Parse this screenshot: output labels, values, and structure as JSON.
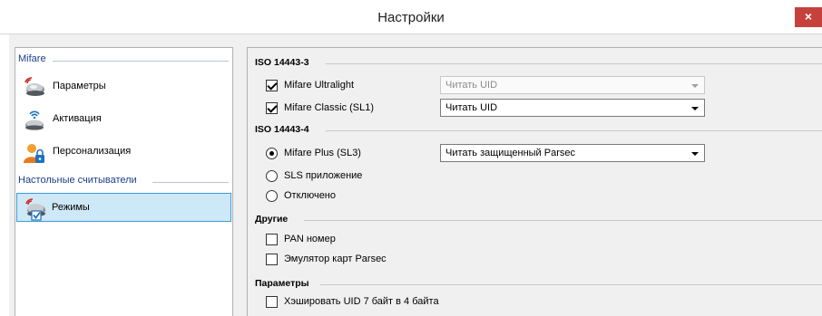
{
  "window": {
    "title": "Настройки",
    "close_label": "×"
  },
  "sidebar": {
    "groups": [
      {
        "header": "Mifare",
        "items": [
          {
            "label": "Параметры",
            "icon": "reader-signal-icon"
          },
          {
            "label": "Активация",
            "icon": "reader-wifi-icon"
          },
          {
            "label": "Персонализация",
            "icon": "user-lock-icon"
          }
        ]
      },
      {
        "header": "Настольные считыватели",
        "items": [
          {
            "label": "Режимы",
            "icon": "reader-check-icon",
            "selected": true
          }
        ]
      }
    ]
  },
  "settings": {
    "iso14443_3": {
      "title": "ISO 14443-3",
      "rows": [
        {
          "label": "Mifare Ultralight",
          "checked": true,
          "combo_value": "Читать UID",
          "combo_enabled": false
        },
        {
          "label": "Mifare Classic (SL1)",
          "checked": true,
          "combo_value": "Читать UID",
          "combo_enabled": true
        }
      ]
    },
    "iso14443_4": {
      "title": "ISO 14443-4",
      "options": [
        {
          "label": "Mifare Plus (SL3)",
          "selected": true,
          "combo_value": "Читать защищенный Parsec"
        },
        {
          "label": "SLS приложение",
          "selected": false
        },
        {
          "label": "Отключено",
          "selected": false
        }
      ]
    },
    "other": {
      "title": "Другие",
      "items": [
        {
          "label": "PAN номер",
          "checked": false
        },
        {
          "label": "Эмулятор карт Parsec",
          "checked": false
        }
      ]
    },
    "params": {
      "title": "Параметры",
      "items": [
        {
          "label": "Хэшировать UID 7 байт в 4 байта",
          "checked": false
        }
      ]
    }
  },
  "colors": {
    "accent": "#3d9ad8",
    "selection_bg": "#cde8f7",
    "close_button": "#c7413c",
    "group_header": "#1a3f88"
  }
}
